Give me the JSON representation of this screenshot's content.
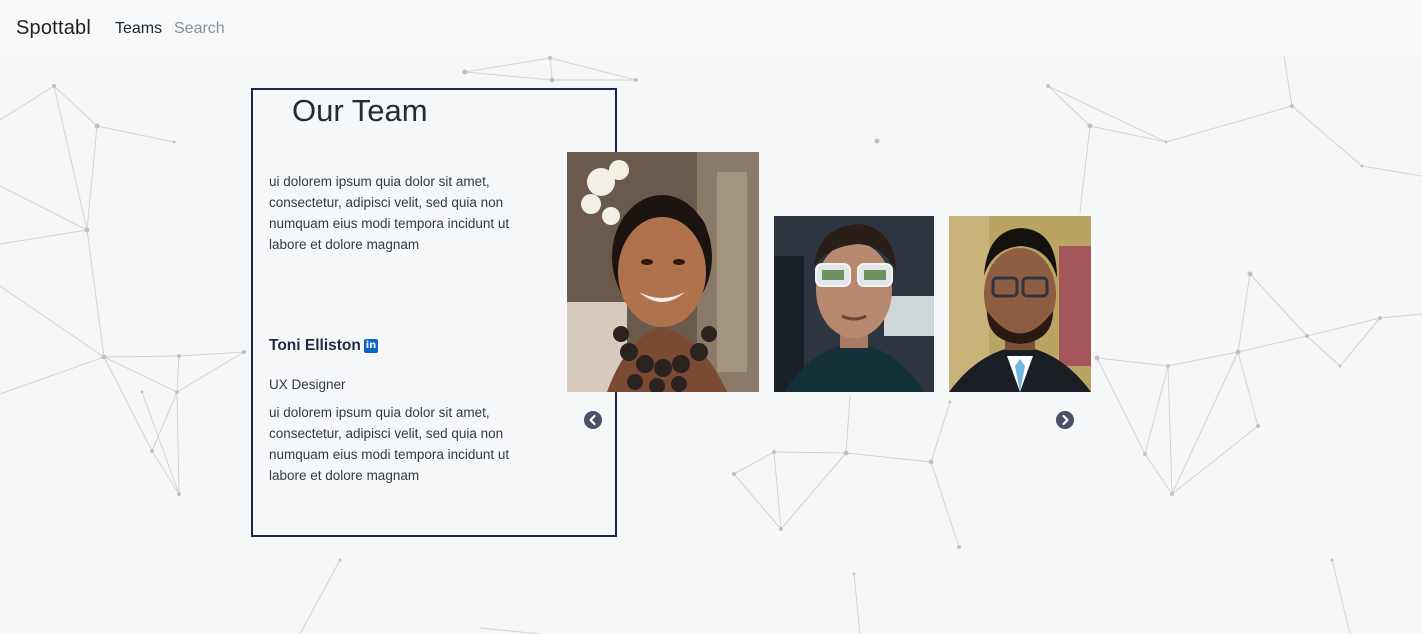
{
  "navbar": {
    "brand": "Spottabl",
    "links": [
      {
        "label": "Teams"
      },
      {
        "label": "Search"
      }
    ]
  },
  "team": {
    "heading": "Our Team",
    "intro": "ui dolorem ipsum quia dolor sit amet, consectetur, adipisci velit, sed quia non numquam eius modi tempora incidunt ut labore et dolore magnam",
    "member": {
      "name": "Toni Elliston",
      "social_icon": "linkedin-icon",
      "social_icon_text": "in",
      "role": "UX Designer",
      "bio": "ui dolorem ipsum quia dolor sit amet, consectetur, adipisci velit, sed quia non numquam eius modi tempora incidunt ut labore et dolore magnam"
    }
  },
  "carousel": {
    "prev_icon": "chevron-left-circle-icon",
    "next_icon": "chevron-right-circle-icon",
    "photos": [
      {
        "name": "team-photo-woman-flower"
      },
      {
        "name": "team-photo-man-sunglasses"
      },
      {
        "name": "team-photo-man-glasses"
      }
    ]
  },
  "colors": {
    "accent": "#1d2550",
    "background": "#f6f7f8",
    "navbar": "#f8f9fa",
    "linkedin": "#0a66c2",
    "arrow": "#4a5068"
  }
}
